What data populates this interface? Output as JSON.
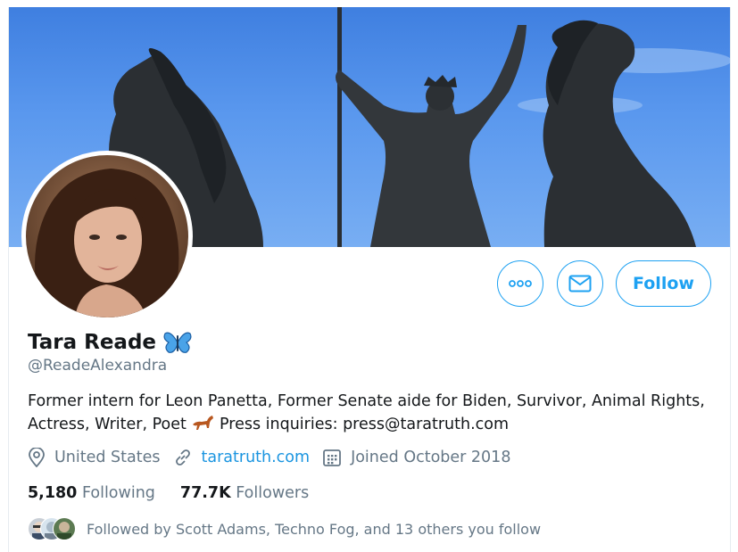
{
  "profile": {
    "display_name": "Tara Reade",
    "handle": "@ReadeAlexandra",
    "bio_part1": "Former intern for Leon Panetta, Former Senate aide for Biden, Survivor, Animal Rights, Actress, Writer, Poet",
    "bio_part2": "Press inquiries: press@taratruth.com",
    "location": "United States",
    "website": "taratruth.com",
    "joined": "Joined October 2018",
    "following_count": "5,180",
    "following_label": "Following",
    "followers_count": "77.7K",
    "followers_label": "Followers",
    "followed_by": "Followed by Scott Adams, Techno Fog, and 13 others you follow"
  },
  "actions": {
    "follow_label": "Follow",
    "more_icon": "more-icon",
    "message_icon": "envelope-icon"
  },
  "icons": {
    "location": "location-pin-icon",
    "link": "link-icon",
    "calendar": "calendar-icon",
    "butterfly": "butterfly-emoji",
    "horse": "horse-emoji"
  },
  "colors": {
    "accent": "#1da1f2",
    "link": "#1b95e0",
    "secondary_text": "#657786",
    "primary_text": "#14171a",
    "banner_sky": "#5a98ee"
  }
}
